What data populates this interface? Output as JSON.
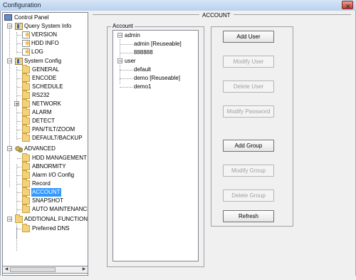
{
  "window": {
    "title": "Configuration"
  },
  "tree": {
    "items": [
      {
        "label": "Control Panel",
        "icon": "monitor"
      },
      {
        "label": "Query System Info",
        "icon": "config",
        "expander": "−"
      },
      {
        "label": "VERSION",
        "icon": "doc"
      },
      {
        "label": "HDD INFO",
        "icon": "doc"
      },
      {
        "label": "LOG",
        "icon": "doc"
      },
      {
        "label": "System Config",
        "icon": "config",
        "expander": "−"
      },
      {
        "label": "GENERAL",
        "icon": "folder"
      },
      {
        "label": "ENCODE",
        "icon": "folder"
      },
      {
        "label": "SCHEDULE",
        "icon": "folder"
      },
      {
        "label": "RS232",
        "icon": "folder"
      },
      {
        "label": "NETWORK",
        "icon": "folder",
        "expander": "+"
      },
      {
        "label": "ALARM",
        "icon": "folder"
      },
      {
        "label": "DETECT",
        "icon": "folder"
      },
      {
        "label": "PAN/TILT/ZOOM",
        "icon": "folder"
      },
      {
        "label": "DEFAULT/BACKUP",
        "icon": "folder"
      },
      {
        "label": "ADVANCED",
        "icon": "gears",
        "expander": "−"
      },
      {
        "label": "HDD MANAGEMENT",
        "icon": "folder"
      },
      {
        "label": "ABNORMITY",
        "icon": "folder"
      },
      {
        "label": "Alarm I/O Config",
        "icon": "folder"
      },
      {
        "label": "Record",
        "icon": "folder"
      },
      {
        "label": "ACCOUNT",
        "icon": "folder",
        "selected": true
      },
      {
        "label": "SNAPSHOT",
        "icon": "folder"
      },
      {
        "label": "AUTO MAINTENANCE",
        "icon": "folder"
      },
      {
        "label": "ADDTIONAL FUNCTION",
        "icon": "folder",
        "expander": "−"
      },
      {
        "label": "Preferred DNS",
        "icon": "folder"
      }
    ]
  },
  "panel": {
    "title": "ACCOUNT",
    "group_label": "Account",
    "accounts": [
      {
        "label": "admin",
        "expander": "−"
      },
      {
        "label": "admin [Reuseable]"
      },
      {
        "label": "888888"
      },
      {
        "label": "user",
        "expander": "−"
      },
      {
        "label": "default"
      },
      {
        "label": "demo [Reuseable]"
      },
      {
        "label": "demo1"
      }
    ]
  },
  "buttons": {
    "add_user": "Add User",
    "modify_user": "Modify User",
    "delete_user": "Delete User",
    "modify_password": "Modify Password",
    "add_group": "Add Group",
    "modify_group": "Modify Group",
    "delete_group": "Delete Group",
    "refresh": "Refresh"
  },
  "icons": {
    "close": "close-icon",
    "scroll_left": "scroll-left-arrow-icon",
    "scroll_right": "scroll-right-arrow-icon"
  },
  "colors": {
    "selection": "#3399ff",
    "window_bg": "#f0f0f0",
    "disabled_text": "#a0a0a0"
  }
}
